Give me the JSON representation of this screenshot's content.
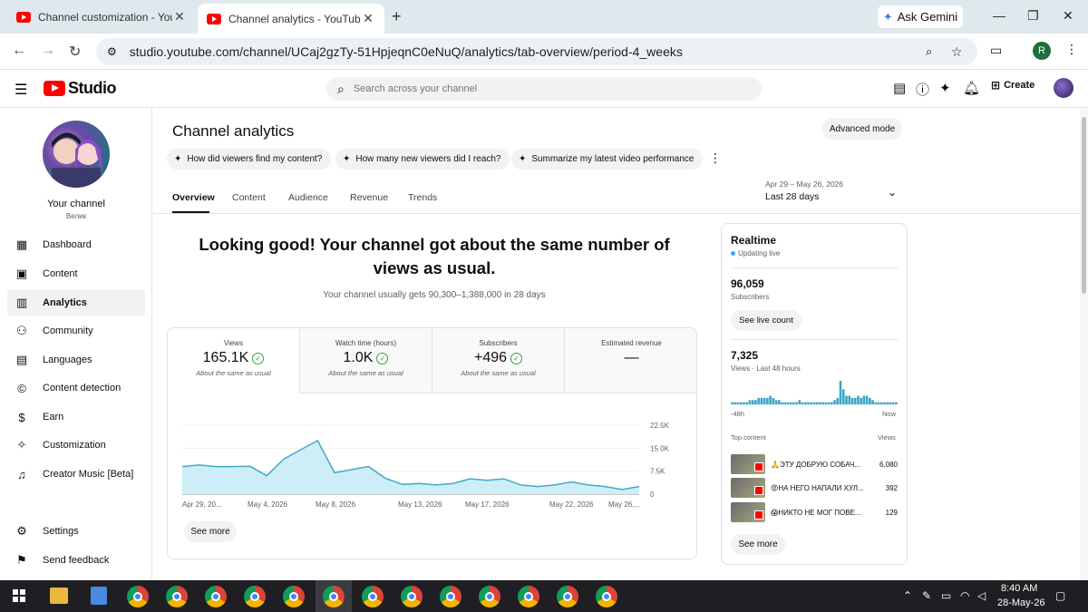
{
  "browser": {
    "tabs": [
      {
        "title": "Channel customization - YouTu"
      },
      {
        "title": "Channel analytics - YouTube St"
      }
    ],
    "gemini_label": "Ask Gemini",
    "url": "studio.youtube.com/channel/UCaj2gzTy-51HpjeqnC0eNuQ/analytics/tab-overview/period-4_weeks",
    "profile_initial": "R"
  },
  "header": {
    "logo_text": "Studio",
    "search_placeholder": "Search across your channel",
    "create_label": "Create"
  },
  "sidebar": {
    "channel_label": "Your channel",
    "channel_handle": "Велик",
    "items": [
      {
        "label": "Dashboard",
        "icon": "dashboard-icon"
      },
      {
        "label": "Content",
        "icon": "content-icon"
      },
      {
        "label": "Analytics",
        "icon": "analytics-icon"
      },
      {
        "label": "Community",
        "icon": "community-icon"
      },
      {
        "label": "Languages",
        "icon": "languages-icon"
      },
      {
        "label": "Content detection",
        "icon": "copyright-icon"
      },
      {
        "label": "Earn",
        "icon": "dollar-icon"
      },
      {
        "label": "Customization",
        "icon": "wand-icon"
      },
      {
        "label": "Creator Music [Beta]",
        "icon": "music-icon"
      }
    ],
    "bottom_items": [
      {
        "label": "Settings",
        "icon": "gear-icon"
      },
      {
        "label": "Send feedback",
        "icon": "feedback-icon"
      }
    ]
  },
  "main": {
    "title": "Channel analytics",
    "advanced_label": "Advanced mode",
    "chips": [
      "How did viewers find my content?",
      "How many new viewers did I reach?",
      "Summarize my latest video performance"
    ],
    "tabs": [
      "Overview",
      "Content",
      "Audience",
      "Revenue",
      "Trends"
    ],
    "date_range": "Apr 29 – May 26, 2026",
    "date_label": "Last 28 days",
    "headline": "Looking good! Your channel got about the same number of views as usual.",
    "subline": "Your channel usually gets 90,300–1,388,000 in 28 days",
    "metrics": [
      {
        "label": "Views",
        "value": "165.1K",
        "note": "About the same as usual",
        "check": true
      },
      {
        "label": "Watch time (hours)",
        "value": "1.0K",
        "note": "About the same as usual",
        "check": true
      },
      {
        "label": "Subscribers",
        "value": "+496",
        "note": "About the same as usual",
        "check": true
      },
      {
        "label": "Estimated revenue",
        "value": "—",
        "note": "",
        "check": false
      }
    ],
    "see_more_label": "See more"
  },
  "chart_data": {
    "type": "area",
    "x": [
      "Apr 29, 20...",
      "May 4, 2026",
      "May 8, 2026",
      "May 13, 2026",
      "May 17, 2026",
      "May 22, 2026",
      "May 26,..."
    ],
    "y_ticks": [
      "22.5K",
      "15.0K",
      "7.5K",
      "0"
    ],
    "ylim": [
      0,
      22500
    ],
    "series": [
      {
        "values": [
          9000,
          9500,
          9000,
          9000,
          9100,
          6000,
          11500,
          14500,
          17500,
          7000,
          8000,
          9000,
          5200,
          3200,
          3500,
          3000,
          3500,
          5000,
          4500,
          5000,
          3000,
          2500,
          3000,
          4000,
          3000,
          2500,
          1500,
          2500
        ]
      }
    ]
  },
  "realtime": {
    "title": "Realtime",
    "live_label": "Updating live",
    "subscribers": "96,059",
    "subscribers_label": "Subscribers",
    "live_count_label": "See live count",
    "views": "7,325",
    "views_label": "Views · Last 48 hours",
    "bars": [
      1,
      1,
      1,
      1,
      1,
      1,
      2,
      2,
      2,
      3,
      3,
      3,
      3,
      4,
      3,
      2,
      2,
      1,
      1,
      1,
      1,
      1,
      1,
      2,
      1,
      1,
      1,
      1,
      1,
      1,
      1,
      1,
      1,
      1,
      1,
      2,
      3,
      11,
      7,
      4,
      4,
      3,
      3,
      4,
      3,
      4,
      4,
      3,
      2,
      1,
      1,
      1,
      1,
      1,
      1,
      1,
      1
    ],
    "axis_left": "-48h",
    "axis_right": "Now",
    "top_content_label": "Top content",
    "top_views_label": "Views",
    "top_content": [
      {
        "title": "🙏ЭТУ ДОБРУЮ СОБАЧ...",
        "views": "6,080"
      },
      {
        "title": "😡НА НЕГО НАПАЛИ ХУЛ...",
        "views": "392"
      },
      {
        "title": "😱НИКТО НЕ МОГ ПОВЕ...",
        "views": "129"
      }
    ],
    "see_more_label": "See more"
  },
  "taskbar": {
    "time": "8:40 AM",
    "date": "28-May-26"
  }
}
